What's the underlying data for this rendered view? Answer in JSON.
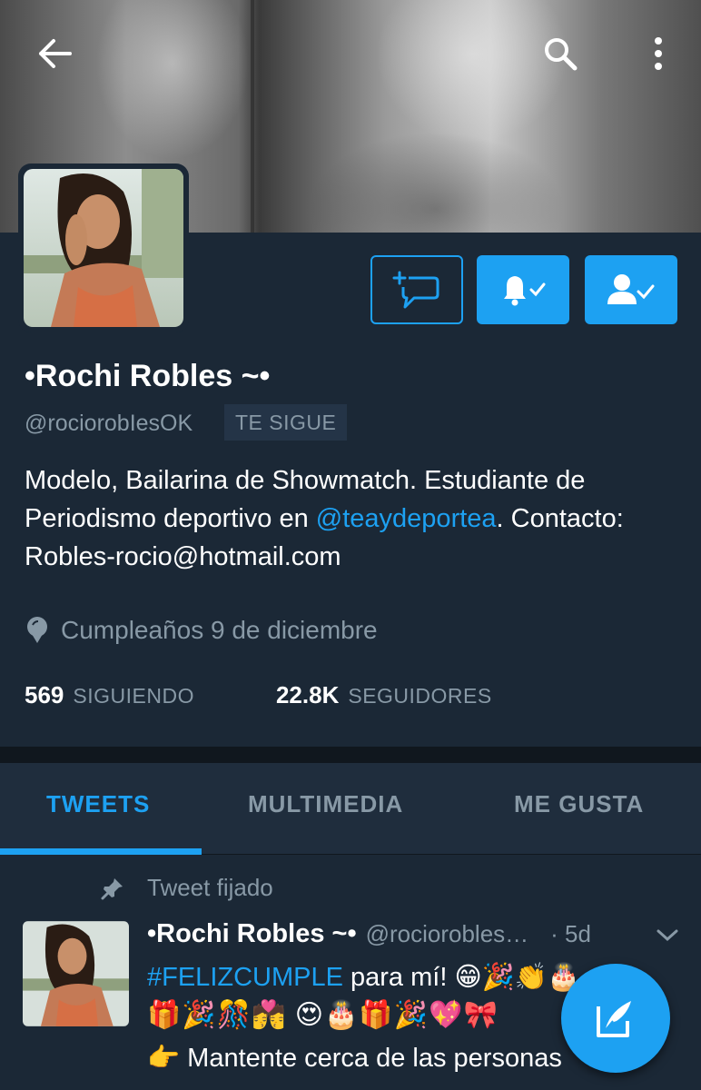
{
  "profile": {
    "name": "•Rochi Robles ~•",
    "handle": "@rociorobIesOK",
    "follows_you": "TE SIGUE",
    "bio_prefix": "Modelo, Bailarina de Showmatch. Estudiante de Periodismo deportivo en ",
    "bio_mention": "@teaydeportea",
    "bio_suffix": ". Contacto: Robles-rocio@hotmail.com",
    "birthday": "Cumpleaños 9 de diciembre",
    "following_count": "569",
    "following_label": "SIGUIENDO",
    "followers_count": "22.8K",
    "followers_label": "SEGUIDORES"
  },
  "tabs": [
    {
      "label": "TWEETS"
    },
    {
      "label": "MULTIMEDIA"
    },
    {
      "label": "ME GUSTA"
    }
  ],
  "pinned_tweet": {
    "pinned_label": "Tweet fijado",
    "name": "•Rochi Robles ~•",
    "handle": "@rocioroblesOK",
    "handle_display": "@rociorobles…",
    "time": "· 5d",
    "hashtag": "#FELIZCUMPLE",
    "line1_rest": " para mí! 😁🎉👏🎂",
    "emoji_row": "🎁🎉🎊💏 😍🎂🎁🎉💖🎀",
    "line3": "👉  Mantente cerca de las personas"
  },
  "colors": {
    "background": "#1b2836",
    "accent": "#1da1f2",
    "muted": "#8899a6"
  },
  "icons": [
    "back-arrow-icon",
    "search-icon",
    "more-vert-icon",
    "add-to-list-icon",
    "notifications-on-icon",
    "following-check-icon",
    "location-pin-icon",
    "pin-icon",
    "chevron-down-icon",
    "compose-icon"
  ]
}
